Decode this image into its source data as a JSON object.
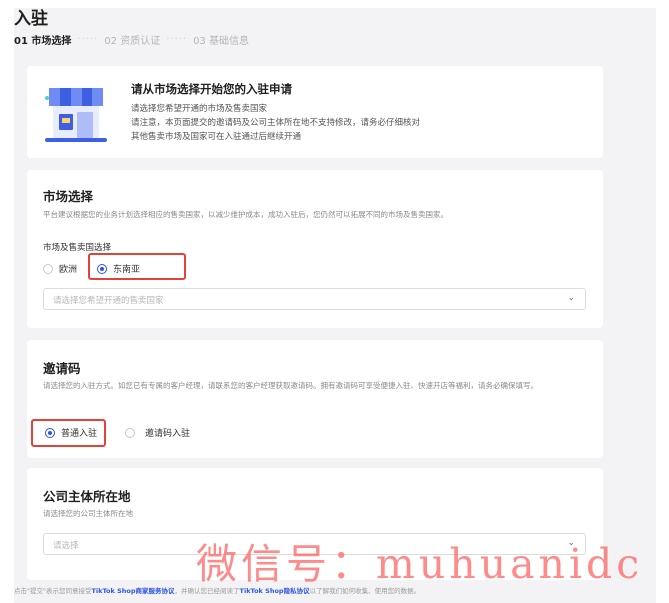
{
  "header": {
    "title": "入驻",
    "steps": [
      {
        "label": "01 市场选择"
      },
      {
        "label": "02 资质认证"
      },
      {
        "label": "03 基础信息"
      }
    ]
  },
  "banner": {
    "title": "请从市场选择开始您的入驻申请",
    "lines": [
      "请选择您希望开通的市场及售卖国家",
      "请注意，本页面提交的邀请码及公司主体所在地不支持修改，请务必仔细核对",
      "其他售卖市场及国家可在入驻通过后继续开通"
    ]
  },
  "market": {
    "title": "市场选择",
    "desc": "平台建议根据您的业务计划选择相应的售卖国家，以减少维护成本，成功入驻后，您仍然可以拓展不同的市场及售卖国家。",
    "field_label": "市场及售卖国选择",
    "options": [
      {
        "label": "欧洲",
        "checked": false
      },
      {
        "label": "东南亚",
        "checked": true
      }
    ],
    "country_placeholder": "请选择您希望开通的售卖国家"
  },
  "invite": {
    "title": "邀请码",
    "desc": "请选择您的入驻方式。如您已有专属的客户经理，请联系您的客户经理获取邀请码。拥有邀请码可享受便捷入驻、快速开店等福利，请务必确保填写。",
    "options": [
      {
        "label": "普通入驻",
        "checked": true
      },
      {
        "label": "邀请码入驻",
        "checked": false
      }
    ]
  },
  "company": {
    "title": "公司主体所在地",
    "desc": "请选择您的公司主体所在地",
    "placeholder": "请选择"
  },
  "footer": {
    "prefix": "点击\"提交\"表示您同意接受",
    "link1": "TikTok Shop商家服务协议",
    "middle": "，并确认您已经阅读了",
    "link2": "TikTok Shop隐私协议",
    "suffix": "以了解我们如何收集、使用您的数据。"
  },
  "watermark": "微信号：muhuanidc",
  "colors": {
    "accent": "#2e54e6",
    "highlight": "#e5413b",
    "watermark": "#ff5a5a"
  }
}
